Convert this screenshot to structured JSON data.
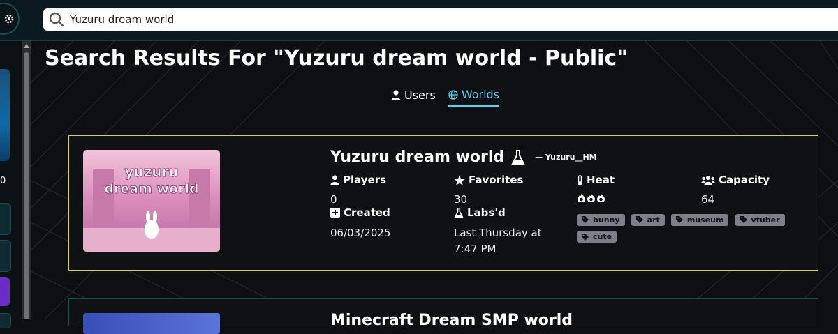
{
  "search": {
    "value": "Yuzuru dream world"
  },
  "sidebar": {
    "count": "0"
  },
  "heading": "Search Results For \"Yuzuru dream world - Public\"",
  "tabs": [
    {
      "label": "Users",
      "icon": "user-icon"
    },
    {
      "label": "Worlds",
      "icon": "globe-icon",
      "active": true
    }
  ],
  "results": [
    {
      "thumb_text": [
        "yuzuru",
        "dream world"
      ],
      "title": "Yuzuru dream world",
      "author": "— Yuzuru__HM",
      "players_label": "Players",
      "players": "0",
      "favorites_label": "Favorites",
      "favorites": "30",
      "heat_label": "Heat",
      "heat_icons": "fire-icon x3",
      "capacity_label": "Capacity",
      "capacity": "64",
      "created_label": "Created",
      "created": "06/03/2025",
      "labs_label": "Labs'd",
      "labs_line1": "Last Thursday at",
      "labs_line2": "7:47 PM",
      "tags": [
        "bunny",
        "art",
        "museum",
        "vtuber",
        "cute"
      ]
    },
    {
      "title": "Minecraft Dream SMP world"
    }
  ],
  "colors": {
    "accent": "#5fcfe8",
    "card_border": "#d8cf5a",
    "tag_bg": "#7b8088"
  }
}
